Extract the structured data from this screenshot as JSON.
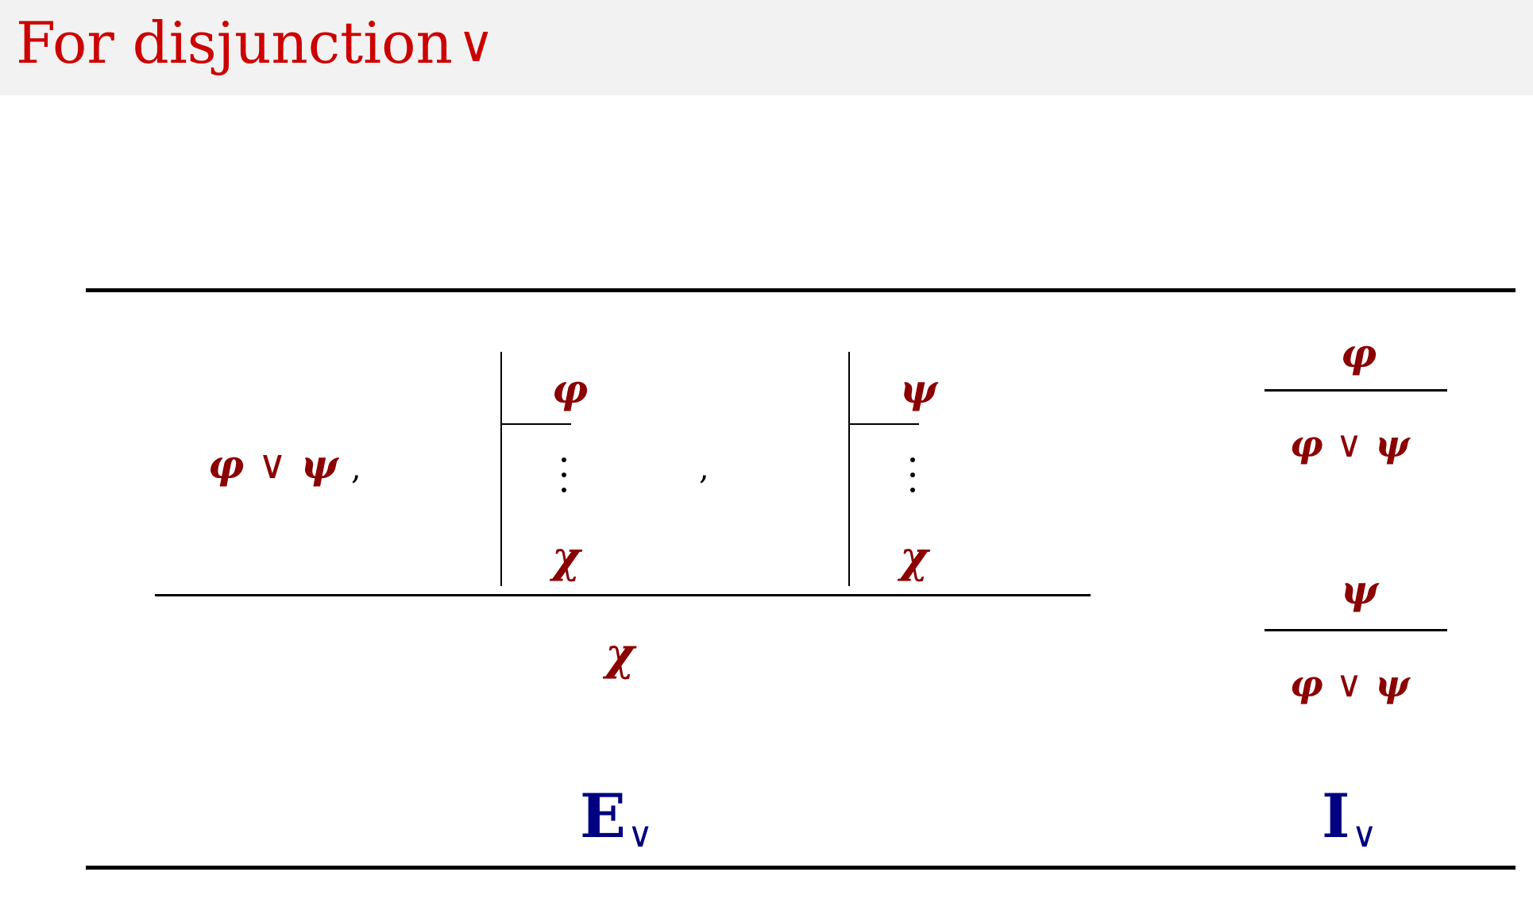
{
  "slide": {
    "title": "For disjunction",
    "title_symbol": "∨",
    "title_color": "#cc0000"
  },
  "elimination": {
    "major_premise": {
      "left": "φ",
      "op": "∨",
      "right": "ψ"
    },
    "separator": ",",
    "subproof_left": {
      "assumption": "φ",
      "conclusion": "χ"
    },
    "subproof_right": {
      "assumption": "ψ",
      "conclusion": "χ"
    },
    "conclusion": "χ",
    "label_main": "E",
    "label_sub": "∨"
  },
  "introduction": {
    "rule1": {
      "premise": "φ",
      "conclusion": {
        "left": "φ",
        "op": "∨",
        "right": "ψ"
      }
    },
    "rule2": {
      "premise": "ψ",
      "conclusion": {
        "left": "φ",
        "op": "∨",
        "right": "ψ"
      }
    },
    "label_main": "I",
    "label_sub": "∨"
  },
  "colors": {
    "formula": "#8b0000",
    "rule_label": "#000080",
    "title_bar_bg": "#f2f2f2"
  }
}
